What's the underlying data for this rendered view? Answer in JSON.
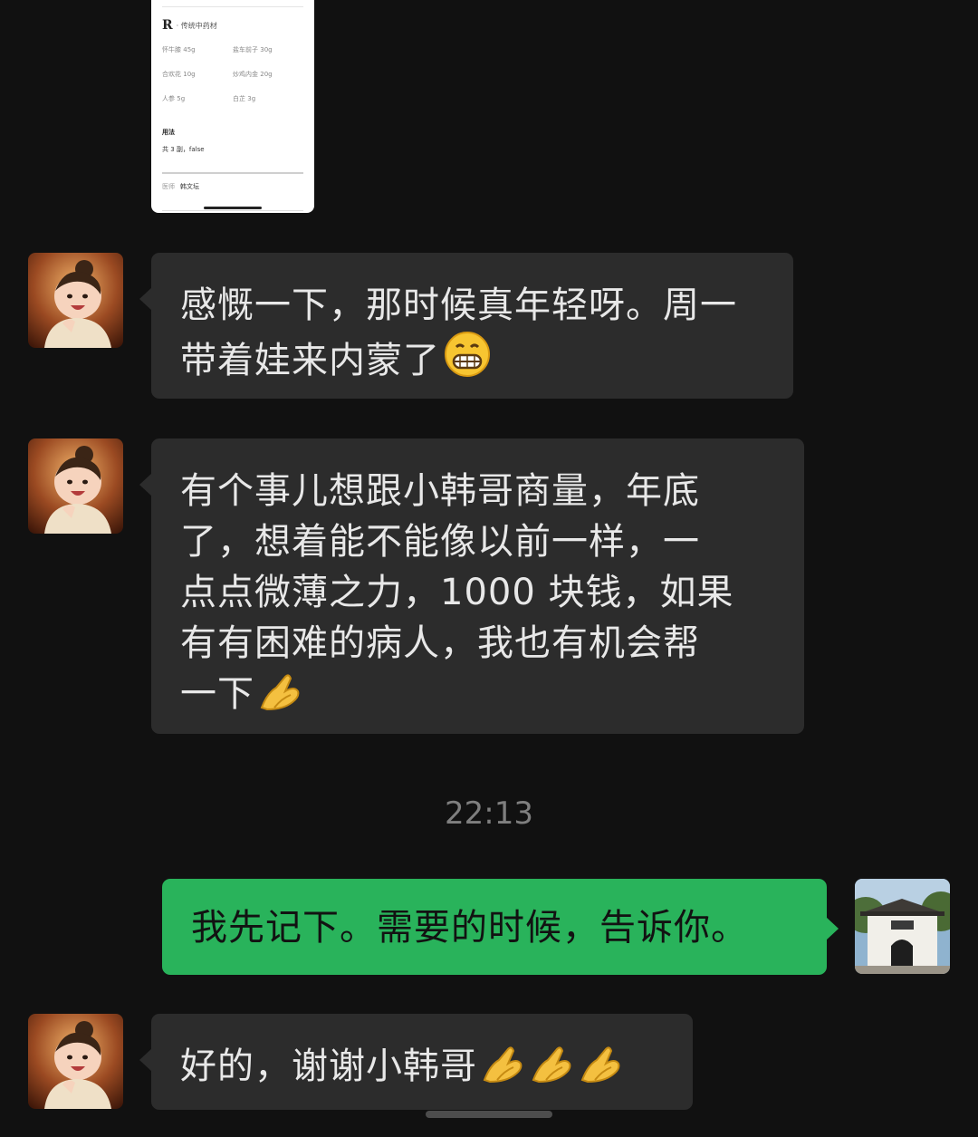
{
  "prescription": {
    "rx_symbol": "R",
    "category": "· 传统中药材",
    "herbs": [
      {
        "name": "怀牛膝",
        "dose": "45g"
      },
      {
        "name": "盐车前子",
        "dose": "30g"
      },
      {
        "name": "合欢花",
        "dose": "10g"
      },
      {
        "name": "炒鸡内金",
        "dose": "20g"
      },
      {
        "name": "人参",
        "dose": "5g"
      },
      {
        "name": "白芷",
        "dose": "3g"
      }
    ],
    "usage_label": "用法",
    "usage_text": "共 3 副，false",
    "doctor_label": "医师",
    "doctor_name": "韩文坛"
  },
  "messages": [
    {
      "direction": "incoming",
      "text": "感慨一下，那时候真年轻呀。周一带着娃来内蒙了",
      "emoji": "grinning-face-icon"
    },
    {
      "direction": "incoming",
      "lines": [
        "有个事儿想跟小韩哥商量，年底",
        "了，想着能不能像以前一样，一",
        "点点微薄之力，1000 块钱，如果",
        "有有困难的病人，我也有机会帮",
        "一下"
      ],
      "emoji": "folded-hands-icon"
    },
    {
      "direction": "outgoing",
      "text": "我先记下。需要的时候，告诉你。"
    },
    {
      "direction": "incoming",
      "text": "好的，谢谢小韩哥",
      "emoji": "folded-hands-icon"
    }
  ],
  "timestamp": "22:13",
  "colors": {
    "background": "#111111",
    "incoming_bubble": "#2c2c2c",
    "outgoing_bubble": "#29b35b",
    "timestamp": "#7f7f7f"
  }
}
